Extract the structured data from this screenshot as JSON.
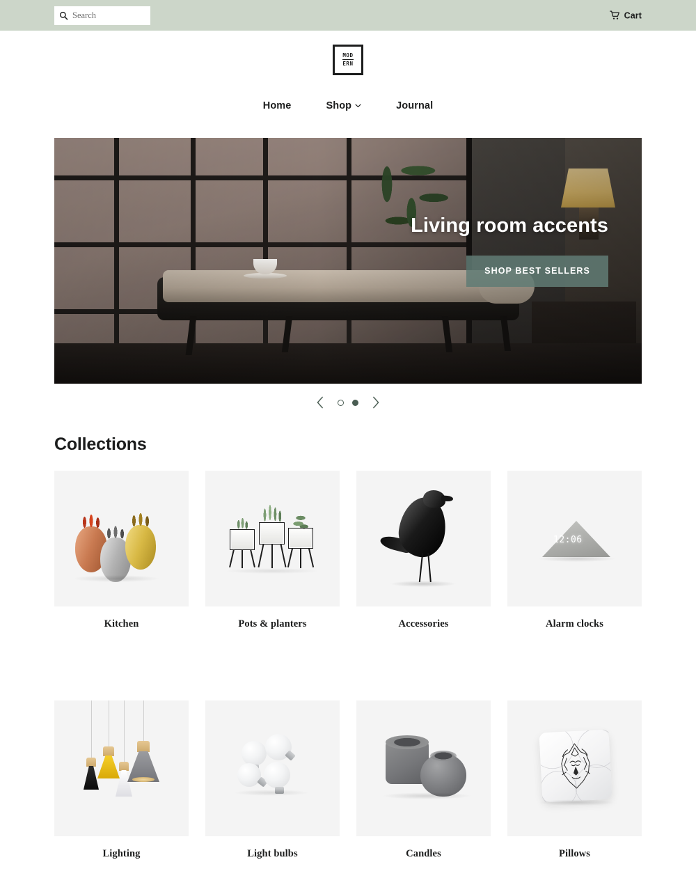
{
  "topbar": {
    "search": {
      "placeholder": "Search",
      "value": "",
      "icon": "search-icon"
    },
    "cart": {
      "label": "Cart",
      "icon": "shopping-cart-icon"
    }
  },
  "brand": {
    "logo_line1": "MOD",
    "logo_line2": "ERN",
    "name": "MODERN"
  },
  "nav": {
    "items": [
      {
        "label": "Home",
        "has_dropdown": false
      },
      {
        "label": "Shop",
        "has_dropdown": true,
        "icon": "chevron-down-icon"
      },
      {
        "label": "Journal",
        "has_dropdown": false
      }
    ]
  },
  "hero": {
    "title": "Living room accents",
    "cta_label": "SHOP BEST SELLERS",
    "cta_color": "#617c74",
    "slide_index": 2,
    "slide_count": 2
  },
  "carousel": {
    "prev_icon": "chevron-left-icon",
    "next_icon": "chevron-right-icon",
    "dots": [
      {
        "state": "ring"
      },
      {
        "state": "filled"
      }
    ],
    "dot_color": "#4a5d53"
  },
  "collections": {
    "heading": "Collections",
    "tile_bg": "#f4f4f4",
    "items": [
      {
        "label": "Kitchen",
        "art": "pineapple-shakers"
      },
      {
        "label": "Pots & planters",
        "art": "plant-stands"
      },
      {
        "label": "Accessories",
        "art": "bird-figurine"
      },
      {
        "label": "Alarm clocks",
        "art": "wooden-clock",
        "clock_time": "12:06"
      },
      {
        "label": "Lighting",
        "art": "pendant-lamps"
      },
      {
        "label": "Light bulbs",
        "art": "led-bulbs"
      },
      {
        "label": "Candles",
        "art": "concrete-holders"
      },
      {
        "label": "Pillows",
        "art": "lion-pillow"
      }
    ]
  },
  "colors": {
    "topbar_bg": "#ccd6c9",
    "accent": "#4a5d53",
    "text": "#1c1d1d"
  }
}
